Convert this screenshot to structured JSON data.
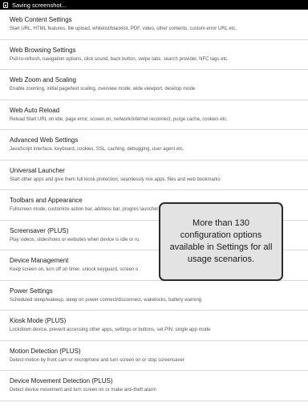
{
  "status_bar": {
    "text": "Saving screenshot...",
    "icon": "screenshot-icon"
  },
  "settings": [
    {
      "title": "Web Content Settings",
      "desc": "Start URL, HTML features, file upload, whitelist/blacklist, PDF, video, other contents, custom error URL etc."
    },
    {
      "title": "Web Browsing Settings",
      "desc": "Pull-to-refresh, navigation options, click sound, back button, swipe tabs, search provider, NFC tags etc."
    },
    {
      "title": "Web Zoom and Scaling",
      "desc": "Enable zooming, initial page/text scaling, overview mode, wide viewport, desktop mode"
    },
    {
      "title": "Web Auto Reload",
      "desc": "Reload Start URL on idle, page error, screen on, network/internet reconnect, purge cache, cookies etc."
    },
    {
      "title": "Advanced Web Settings",
      "desc": "JavaScript interface, keyboard, cookies, SSL, caching, debugging, user agent etc."
    },
    {
      "title": "Universal Launcher",
      "desc": "Start other apps and give them full kiosk protection, seamlessly mix apps, files and web bookmarks"
    },
    {
      "title": "Toolbars and Appearance",
      "desc": "Fullscreen mode, customize action bar, address bar, progres launcher"
    },
    {
      "title": "Screensaver (PLUS)",
      "desc": "Play videos, slideshows or websites when device is idle or ru"
    },
    {
      "title": "Device Management",
      "desc": "Keep screen on, turn off on timer, unlock keyguard, screen o"
    },
    {
      "title": "Power Settings",
      "desc": "Scheduled sleep/wakeup, sleep on power connect/disconnect, wakelocks, battery warning"
    },
    {
      "title": "Kiosk Mode (PLUS)",
      "desc": "Lockdown device, prevent accessing other apps, settings or buttons, set PIN, single app mode"
    },
    {
      "title": "Motion Detection (PLUS)",
      "desc": "Detect motion by front cam or microphone and turn screen on or stop screensaver"
    },
    {
      "title": "Device Movement Detection (PLUS)",
      "desc": "Detect device movement and turn screen on or make anti-theft alarm"
    }
  ],
  "callout": {
    "text": "More than 130 configuration options available in Settings for all usage scenarios."
  }
}
